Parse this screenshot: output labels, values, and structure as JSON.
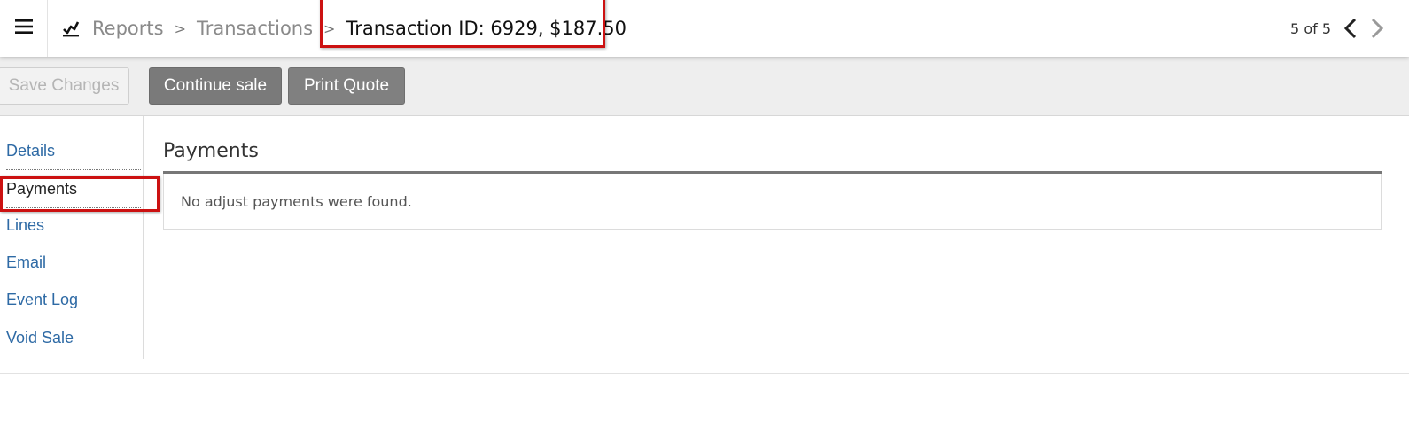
{
  "header": {
    "menu_icon": "hamburger-icon",
    "reports_icon": "reports-chart-icon",
    "breadcrumb": {
      "reports": "Reports",
      "transactions": "Transactions",
      "current": "Transaction ID: 6929, $187.50"
    },
    "pager": {
      "text": "5 of 5",
      "prev_icon": "chevron-left-icon",
      "next_icon": "chevron-right-icon"
    }
  },
  "toolbar": {
    "save_label": "Save Changes",
    "continue_label": "Continue sale",
    "print_label": "Print Quote"
  },
  "sidebar": {
    "items": [
      {
        "label": "Details"
      },
      {
        "label": "Payments"
      },
      {
        "label": "Lines"
      },
      {
        "label": "Email"
      },
      {
        "label": "Event Log"
      },
      {
        "label": "Void Sale"
      }
    ],
    "active": "Payments"
  },
  "main": {
    "section_title": "Payments",
    "empty_message": "No adjust payments were found."
  },
  "colors": {
    "link": "#2e6aa5",
    "highlight": "#cc1111",
    "button_dark": "#7a7a7a",
    "toolbar_bg": "#eeeeee"
  }
}
